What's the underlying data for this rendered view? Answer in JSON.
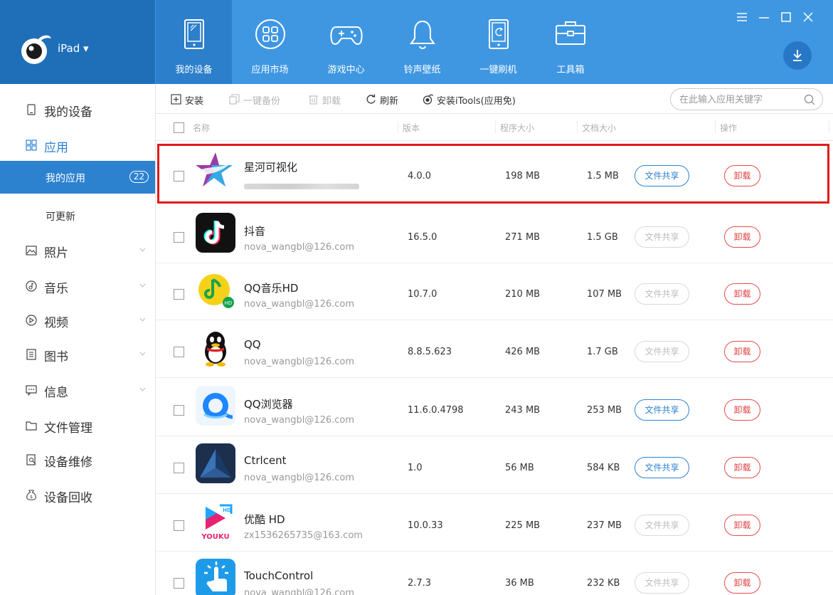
{
  "device": {
    "name": "iPad ▾"
  },
  "nav": [
    {
      "label": "我的设备",
      "icon": "tablet-icon",
      "active": true
    },
    {
      "label": "应用市场",
      "icon": "app-grid-icon"
    },
    {
      "label": "游戏中心",
      "icon": "gamepad-icon"
    },
    {
      "label": "铃声壁纸",
      "icon": "bell-icon"
    },
    {
      "label": "一键刷机",
      "icon": "flash-icon"
    },
    {
      "label": "工具箱",
      "icon": "toolbox-icon"
    }
  ],
  "sidebar": {
    "items": [
      {
        "label": "我的设备",
        "icon": "phone-icon"
      },
      {
        "label": "应用",
        "icon": "app-grid-icon"
      },
      {
        "label": "照片",
        "icon": "photo-icon"
      },
      {
        "label": "音乐",
        "icon": "music-icon"
      },
      {
        "label": "视频",
        "icon": "video-icon"
      },
      {
        "label": "图书",
        "icon": "book-icon"
      },
      {
        "label": "信息",
        "icon": "message-icon"
      },
      {
        "label": "文件管理",
        "icon": "folder-icon"
      },
      {
        "label": "设备维修",
        "icon": "repair-icon"
      },
      {
        "label": "设备回收",
        "icon": "recycle-icon"
      }
    ],
    "sub": [
      {
        "label": "我的应用",
        "count": "22",
        "active": true
      },
      {
        "label": "可更新"
      }
    ]
  },
  "toolbar": {
    "install": "安装",
    "backup": "一键备份",
    "uninstall": "卸载",
    "refresh": "刷新",
    "install_itools": "安装iTools(应用免)",
    "search_placeholder": "在此输入应用关键字"
  },
  "table": {
    "headers": {
      "name": "名称",
      "version": "版本",
      "app_size": "程序大小",
      "doc_size": "文档大小",
      "action": "操作"
    },
    "rows": [
      {
        "name": "星河可视化",
        "account": "",
        "version": "4.0.0",
        "app_size": "198 MB",
        "doc_size": "1.5 MB",
        "share": "文件共享",
        "share_enabled": true,
        "uninstall": "卸载",
        "selected": true
      },
      {
        "name": "抖音",
        "account": "nova_wangbl@126.com",
        "version": "16.5.0",
        "app_size": "271 MB",
        "doc_size": "1.5 GB",
        "share": "文件共享",
        "share_enabled": false,
        "uninstall": "卸载"
      },
      {
        "name": "QQ音乐HD",
        "account": "nova_wangbl@126.com",
        "version": "10.7.0",
        "app_size": "210 MB",
        "doc_size": "107 MB",
        "share": "文件共享",
        "share_enabled": false,
        "uninstall": "卸载"
      },
      {
        "name": "QQ",
        "account": "nova_wangbl@126.com",
        "version": "8.8.5.623",
        "app_size": "426 MB",
        "doc_size": "1.7 GB",
        "share": "文件共享",
        "share_enabled": false,
        "uninstall": "卸载"
      },
      {
        "name": "QQ浏览器",
        "account": "nova_wangbl@126.com",
        "version": "11.6.0.4798",
        "app_size": "243 MB",
        "doc_size": "253 MB",
        "share": "文件共享",
        "share_enabled": true,
        "uninstall": "卸载"
      },
      {
        "name": "Ctrlcent",
        "account": "nova_wangbl@126.com",
        "version": "1.0",
        "app_size": "56 MB",
        "doc_size": "584 KB",
        "share": "文件共享",
        "share_enabled": true,
        "uninstall": "卸载"
      },
      {
        "name": "优酷 HD",
        "account": "zx1536265735@163.com",
        "version": "10.0.33",
        "app_size": "225 MB",
        "doc_size": "237 MB",
        "share": "文件共享",
        "share_enabled": false,
        "uninstall": "卸载"
      },
      {
        "name": "TouchControl",
        "account": "nova_wangbl@126.com",
        "version": "2.7.3",
        "app_size": "36 MB",
        "doc_size": "232 KB",
        "share": "文件共享",
        "share_enabled": false,
        "uninstall": "卸载"
      }
    ]
  },
  "colors": {
    "primary": "#3f97e2",
    "nav_dark": "#1f6fb8",
    "selected_outline": "#e21b1b",
    "uninstall": "#e04040"
  }
}
